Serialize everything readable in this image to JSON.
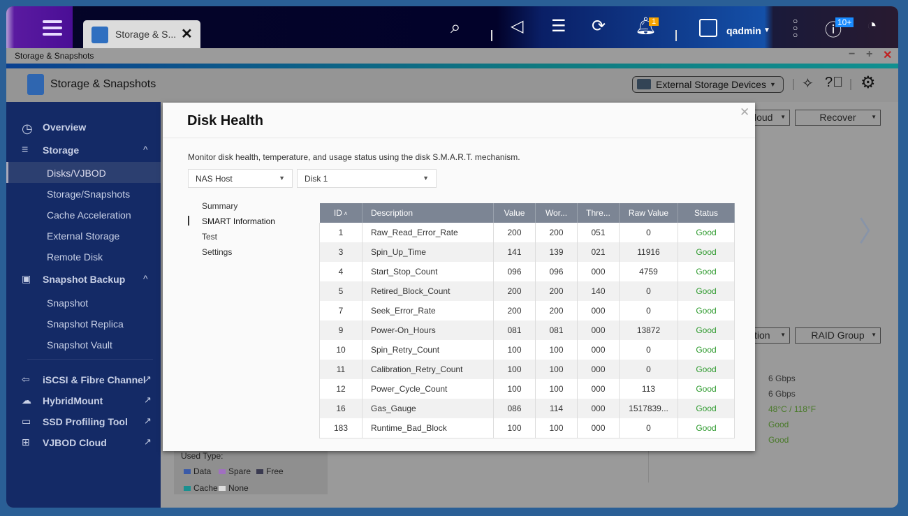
{
  "topbar": {
    "tab_label": "Storage & S...",
    "user": "qadmin",
    "notification_badge": "1",
    "events_badge": "10+"
  },
  "window": {
    "title": "Storage & Snapshots"
  },
  "app": {
    "title": "Storage & Snapshots",
    "device_dropdown": "External Storage Devices"
  },
  "sidebar": {
    "items": [
      {
        "label": "Overview"
      },
      {
        "label": "Storage"
      },
      {
        "label": "Disks/VJBOD"
      },
      {
        "label": "Storage/Snapshots"
      },
      {
        "label": "Cache Acceleration"
      },
      {
        "label": "External Storage"
      },
      {
        "label": "Remote Disk"
      },
      {
        "label": "Snapshot Backup"
      },
      {
        "label": "Snapshot"
      },
      {
        "label": "Snapshot Replica"
      },
      {
        "label": "Snapshot Vault"
      },
      {
        "label": "iSCSI & Fibre Channel"
      },
      {
        "label": "HybridMount"
      },
      {
        "label": "SSD Profiling Tool"
      },
      {
        "label": "VJBOD Cloud"
      }
    ]
  },
  "background": {
    "dd1": "loud",
    "dd2": "Recover",
    "dd3": "tion",
    "dd4": "RAID Group",
    "values": [
      "6 Gbps",
      "6 Gbps",
      "48°C / 118°F",
      "Good",
      "Good"
    ],
    "legend_title": "Used Type:",
    "legend": [
      "Data",
      "Spare",
      "Free",
      "Cache",
      "None"
    ],
    "legend_colors": [
      "#3a5aa8",
      "#a070c0",
      "#3a3a50",
      "#1a9090",
      "#dddddd"
    ]
  },
  "modal": {
    "title": "Disk Health",
    "description": "Monitor disk health, temperature, and usage status using the disk S.M.A.R.T. mechanism.",
    "host_select": "NAS Host",
    "disk_select": "Disk 1",
    "nav": [
      "Summary",
      "SMART Information",
      "Test",
      "Settings"
    ],
    "columns": [
      "ID",
      "Description",
      "Value",
      "Wor...",
      "Thre...",
      "Raw Value",
      "Status"
    ],
    "rows": [
      [
        "1",
        "Raw_Read_Error_Rate",
        "200",
        "200",
        "051",
        "0",
        "Good"
      ],
      [
        "3",
        "Spin_Up_Time",
        "141",
        "139",
        "021",
        "11916",
        "Good"
      ],
      [
        "4",
        "Start_Stop_Count",
        "096",
        "096",
        "000",
        "4759",
        "Good"
      ],
      [
        "5",
        "Retired_Block_Count",
        "200",
        "200",
        "140",
        "0",
        "Good"
      ],
      [
        "7",
        "Seek_Error_Rate",
        "200",
        "200",
        "000",
        "0",
        "Good"
      ],
      [
        "9",
        "Power-On_Hours",
        "081",
        "081",
        "000",
        "13872",
        "Good"
      ],
      [
        "10",
        "Spin_Retry_Count",
        "100",
        "100",
        "000",
        "0",
        "Good"
      ],
      [
        "11",
        "Calibration_Retry_Count",
        "100",
        "100",
        "000",
        "0",
        "Good"
      ],
      [
        "12",
        "Power_Cycle_Count",
        "100",
        "100",
        "000",
        "113",
        "Good"
      ],
      [
        "16",
        "Gas_Gauge",
        "086",
        "114",
        "000",
        "1517839...",
        "Good"
      ],
      [
        "183",
        "Runtime_Bad_Block",
        "100",
        "100",
        "000",
        "0",
        "Good"
      ]
    ]
  }
}
